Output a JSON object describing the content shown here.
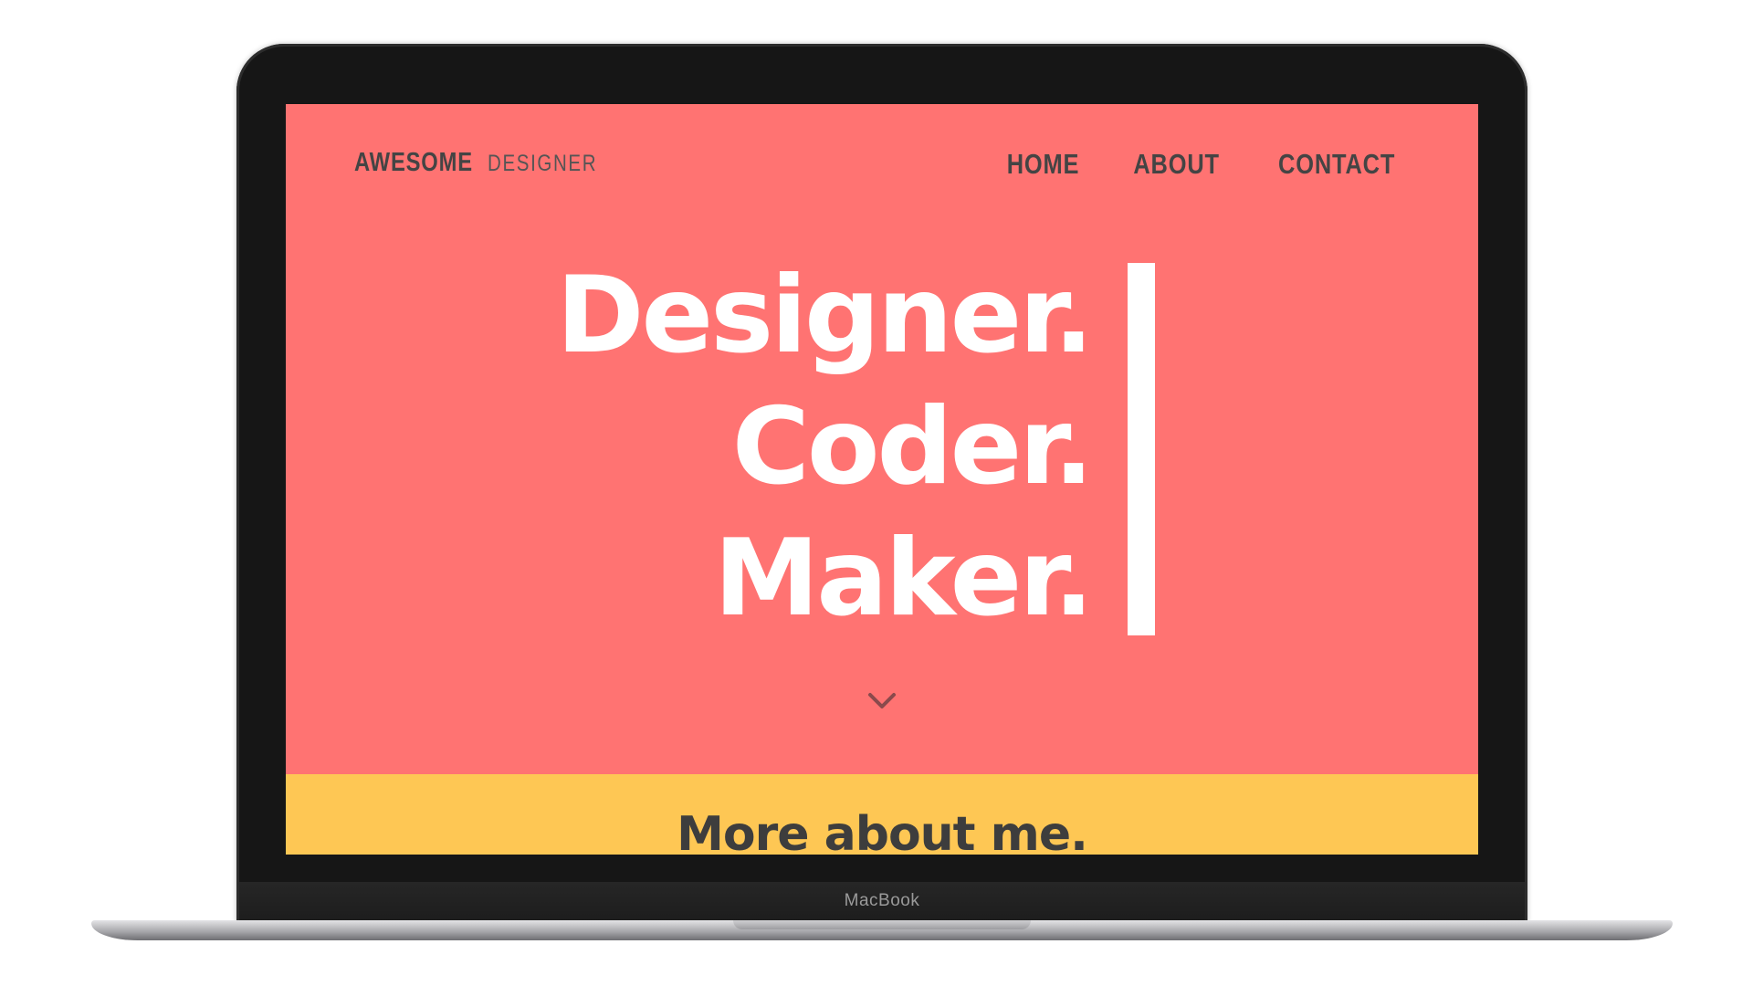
{
  "device": {
    "brand": "MacBook"
  },
  "site": {
    "logo": {
      "primary": "AWESOME",
      "secondary": "DESIGNER"
    },
    "nav": {
      "home": "HOME",
      "about": "ABOUT",
      "contact": "CONTACT"
    },
    "hero": {
      "lines": [
        "Designer.",
        "Coder.",
        "Maker."
      ],
      "scroll_icon": "chevron-down-icon"
    },
    "about": {
      "heading": "More about me."
    },
    "colors": {
      "hero_background": "#ff7372",
      "about_background": "#fec754",
      "text_dark": "#444444",
      "text_light": "#ffffff"
    }
  }
}
